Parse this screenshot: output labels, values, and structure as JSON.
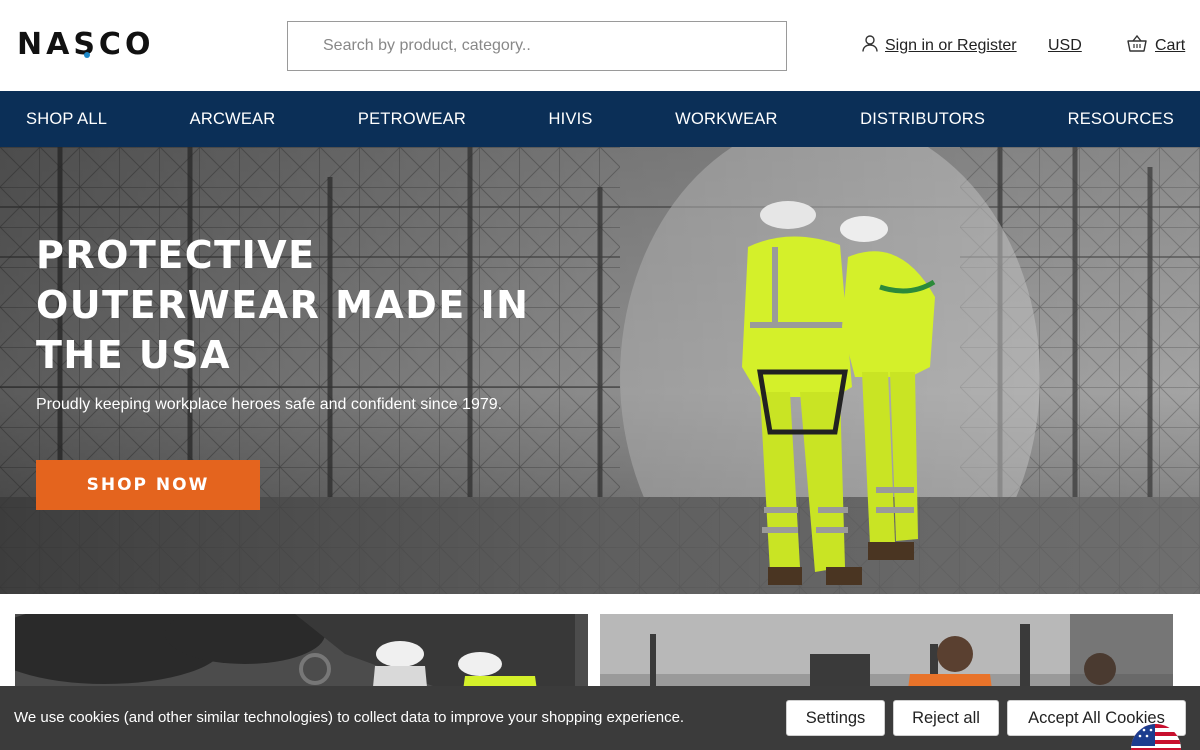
{
  "brand": {
    "logo_text": "NASCO"
  },
  "search": {
    "placeholder": "Search by product, category.."
  },
  "header": {
    "account_label": "Sign in or Register",
    "currency": "USD",
    "cart_label": "Cart"
  },
  "nav": {
    "items": [
      {
        "label": "SHOP ALL"
      },
      {
        "label": "ARCWEAR"
      },
      {
        "label": "PETROWEAR"
      },
      {
        "label": "HIVIS"
      },
      {
        "label": "WORKWEAR"
      },
      {
        "label": "DISTRIBUTORS"
      },
      {
        "label": "RESOURCES"
      }
    ]
  },
  "hero": {
    "title_line1": "PROTECTIVE",
    "title_line2": "OUTERWEAR MADE IN",
    "title_line3": "THE USA",
    "subtitle": "Proudly keeping workplace heroes safe and confident since 1979.",
    "cta_label": "SHOP NOW"
  },
  "cookie_banner": {
    "text": "We use cookies (and other similar technologies) to collect data to improve your shopping experience.",
    "settings_label": "Settings",
    "reject_label": "Reject all",
    "accept_label": "Accept All Cookies"
  },
  "colors": {
    "nav_bg": "#0b2f57",
    "cta_bg": "#e4641e",
    "hivis_yellow": "#d4f02a",
    "cookie_bg": "#3b3b3b"
  },
  "icons": [
    "user-icon",
    "basket-icon",
    "us-flag-icon"
  ]
}
